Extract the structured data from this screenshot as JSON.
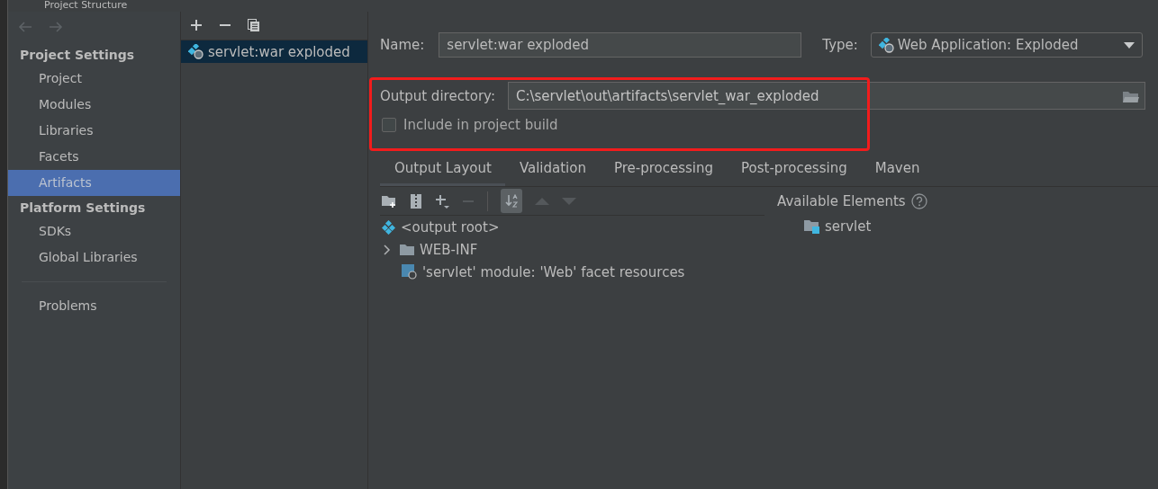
{
  "window": {
    "title": "Project Structure"
  },
  "nav": {
    "back_disabled": true,
    "forward_disabled": true
  },
  "sidebar": {
    "sections": [
      {
        "title": "Project Settings",
        "items": [
          {
            "label": "Project",
            "selected": false
          },
          {
            "label": "Modules",
            "selected": false
          },
          {
            "label": "Libraries",
            "selected": false
          },
          {
            "label": "Facets",
            "selected": false
          },
          {
            "label": "Artifacts",
            "selected": true
          }
        ]
      },
      {
        "title": "Platform Settings",
        "items": [
          {
            "label": "SDKs",
            "selected": false
          },
          {
            "label": "Global Libraries",
            "selected": false
          }
        ]
      },
      {
        "items": [
          {
            "label": "Problems",
            "selected": false
          }
        ]
      }
    ]
  },
  "artifact_list": {
    "toolbar": [
      {
        "kind": "add"
      },
      {
        "kind": "remove"
      },
      {
        "kind": "copy"
      }
    ],
    "items": [
      {
        "label": "servlet:war exploded",
        "selected": true
      }
    ]
  },
  "form": {
    "name_label": "Name:",
    "name_value": "servlet:war exploded",
    "type_label": "Type:",
    "type_value": "Web Application: Exploded",
    "output_label": "Output directory:",
    "output_value": "C:\\servlet\\out\\artifacts\\servlet_war_exploded",
    "include_label": "Include in project build",
    "include_checked": false
  },
  "tabs": [
    {
      "label": "Output Layout",
      "selected": true
    },
    {
      "label": "Validation",
      "selected": false
    },
    {
      "label": "Pre-processing",
      "selected": false
    },
    {
      "label": "Post-processing",
      "selected": false
    },
    {
      "label": "Maven",
      "selected": false
    }
  ],
  "layout_toolbar": [
    {
      "kind": "new-folder",
      "disabled": false
    },
    {
      "kind": "archive",
      "disabled": false
    },
    {
      "kind": "add",
      "disabled": false
    },
    {
      "kind": "remove",
      "disabled": true
    },
    {
      "kind": "sort",
      "disabled": false,
      "on": true
    },
    {
      "kind": "up",
      "disabled": true
    },
    {
      "kind": "down",
      "disabled": true
    }
  ],
  "tree": [
    {
      "kind": "root",
      "label": "<output root>"
    },
    {
      "kind": "folder",
      "label": "WEB-INF",
      "expanded": false
    },
    {
      "kind": "module",
      "label": "'servlet' module: 'Web' facet resources"
    }
  ],
  "available": {
    "title": "Available Elements",
    "items": [
      {
        "kind": "module",
        "label": "servlet"
      }
    ]
  },
  "annotation": {
    "shown": true
  }
}
